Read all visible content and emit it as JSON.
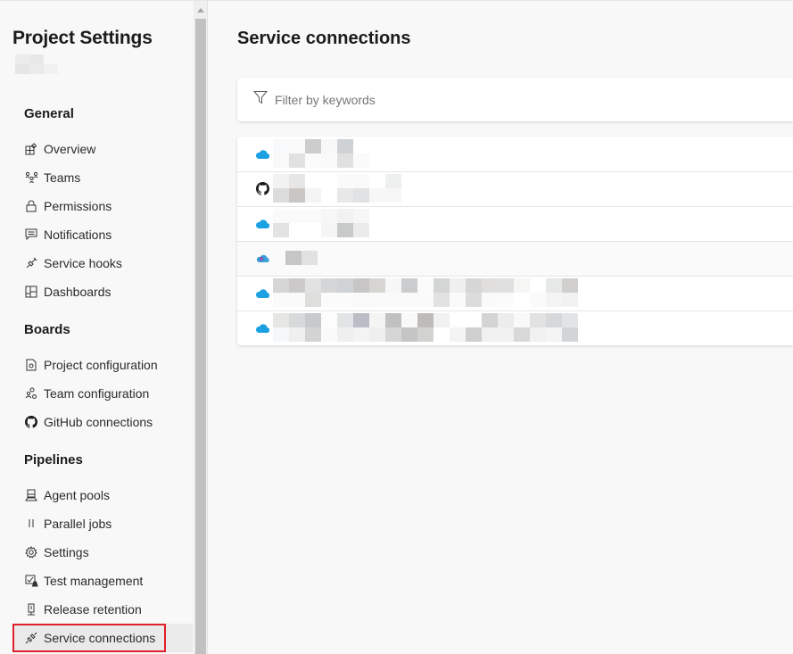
{
  "sidebar": {
    "title": "Project Settings",
    "sections": [
      {
        "heading": "General",
        "items": [
          {
            "label": "Overview",
            "icon": "overview-icon"
          },
          {
            "label": "Teams",
            "icon": "teams-icon"
          },
          {
            "label": "Permissions",
            "icon": "lock-icon"
          },
          {
            "label": "Notifications",
            "icon": "notification-icon"
          },
          {
            "label": "Service hooks",
            "icon": "plug-icon"
          },
          {
            "label": "Dashboards",
            "icon": "dashboard-icon"
          }
        ]
      },
      {
        "heading": "Boards",
        "items": [
          {
            "label": "Project configuration",
            "icon": "project-config-icon"
          },
          {
            "label": "Team configuration",
            "icon": "team-config-icon"
          },
          {
            "label": "GitHub connections",
            "icon": "github-icon"
          }
        ]
      },
      {
        "heading": "Pipelines",
        "items": [
          {
            "label": "Agent pools",
            "icon": "agent-pool-icon"
          },
          {
            "label": "Parallel jobs",
            "icon": "parallel-icon"
          },
          {
            "label": "Settings",
            "icon": "gear-icon"
          },
          {
            "label": "Test management",
            "icon": "test-icon"
          },
          {
            "label": "Release retention",
            "icon": "retention-icon"
          },
          {
            "label": "Service connections",
            "icon": "plug-icon",
            "active": true
          }
        ]
      }
    ]
  },
  "main": {
    "title": "Service connections",
    "filter": {
      "placeholder": "Filter by keywords",
      "value": ""
    },
    "connections": [
      {
        "type": "azure",
        "icon": "azure-cloud-icon",
        "name": "[redacted]"
      },
      {
        "type": "github",
        "icon": "github-icon",
        "name": "[redacted]"
      },
      {
        "type": "azure",
        "icon": "azure-cloud-icon",
        "name": "[redacted]"
      },
      {
        "type": "azure-classic",
        "icon": "azure-classic-icon",
        "name": "[redacted]"
      },
      {
        "type": "azure",
        "icon": "azure-cloud-icon",
        "name": "[redacted]"
      },
      {
        "type": "azure",
        "icon": "azure-cloud-icon",
        "name": "[redacted]"
      }
    ]
  },
  "colors": {
    "azure": "#1ba1e2",
    "active_outline": "#e0202a"
  }
}
